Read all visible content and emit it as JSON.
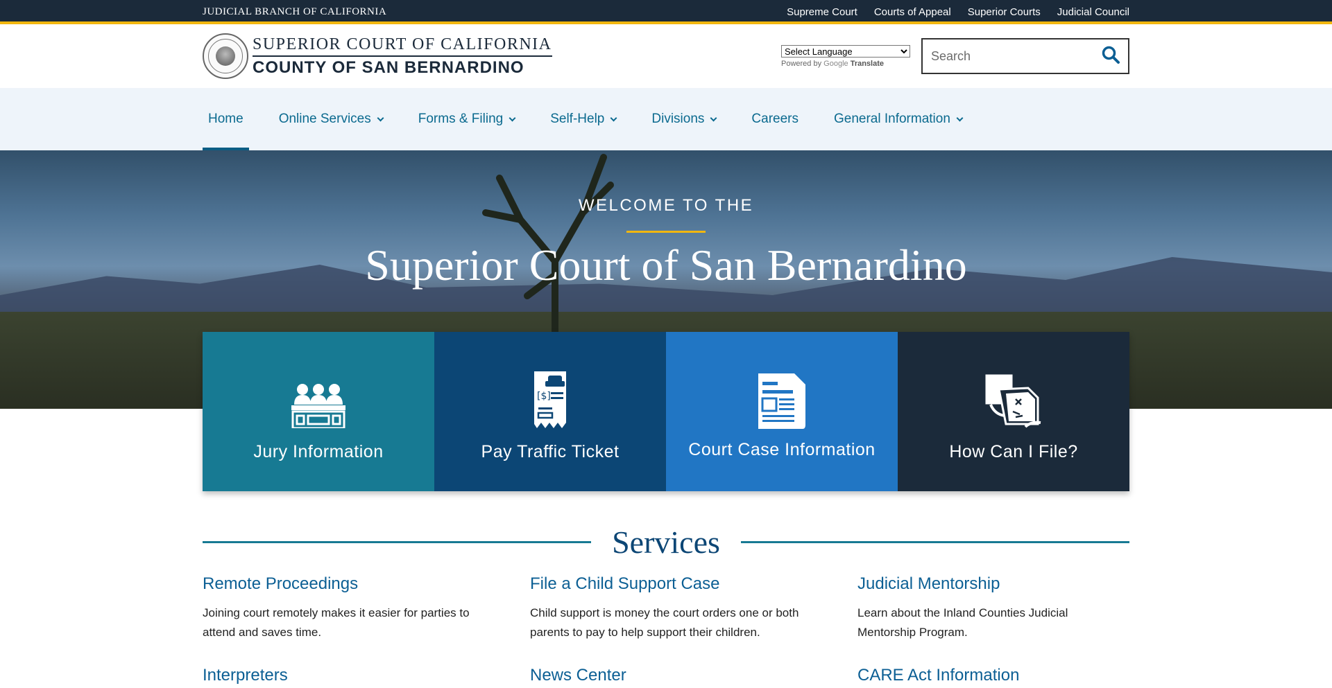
{
  "topbar": {
    "branch": "Judicial Branch of California",
    "links": [
      "Supreme Court",
      "Courts of Appeal",
      "Superior Courts",
      "Judicial Council"
    ]
  },
  "header": {
    "logo_line1": "Superior Court of California",
    "logo_line2": "County of San Bernardino",
    "translate_option": "Select Language",
    "powered_by": "Powered by",
    "google": "Google",
    "translate": "Translate",
    "search_placeholder": "Search"
  },
  "nav": {
    "items": [
      {
        "label": "Home",
        "active": true,
        "dropdown": false
      },
      {
        "label": "Online Services",
        "dropdown": true
      },
      {
        "label": "Forms & Filing",
        "dropdown": true
      },
      {
        "label": "Self-Help",
        "dropdown": true
      },
      {
        "label": "Divisions",
        "dropdown": true
      },
      {
        "label": "Careers",
        "dropdown": false
      },
      {
        "label": "General Information",
        "dropdown": true
      }
    ]
  },
  "hero": {
    "welcome": "Welcome to the",
    "title": "Superior Court of San Bernardino"
  },
  "cards": [
    {
      "label": "Jury Information",
      "icon": "jury-icon",
      "color": "#177a93"
    },
    {
      "label": "Pay Traffic Ticket",
      "icon": "traffic-ticket-icon",
      "color": "#0c4675"
    },
    {
      "label": "Court Case Information",
      "icon": "case-document-icon",
      "color": "#2176c4"
    },
    {
      "label": "How Can I File?",
      "icon": "file-documents-icon",
      "color": "#1b2a3a"
    }
  ],
  "services": {
    "heading": "Services",
    "items": [
      {
        "title": "Remote Proceedings",
        "desc": "Joining court remotely makes it easier for parties to attend and saves time."
      },
      {
        "title": "File a Child Support Case",
        "desc": "Child support is money the court orders one or both parents to pay to help support their children."
      },
      {
        "title": "Judicial Mentorship",
        "desc": "Learn about the Inland Counties Judicial Mentorship Program."
      }
    ],
    "row2": [
      "Interpreters",
      "News Center",
      "CARE Act Information"
    ]
  },
  "colors": {
    "navy": "#1b2a3a",
    "gold": "#f2b70f",
    "teal": "#177a93",
    "link_blue": "#0b6a8f"
  }
}
